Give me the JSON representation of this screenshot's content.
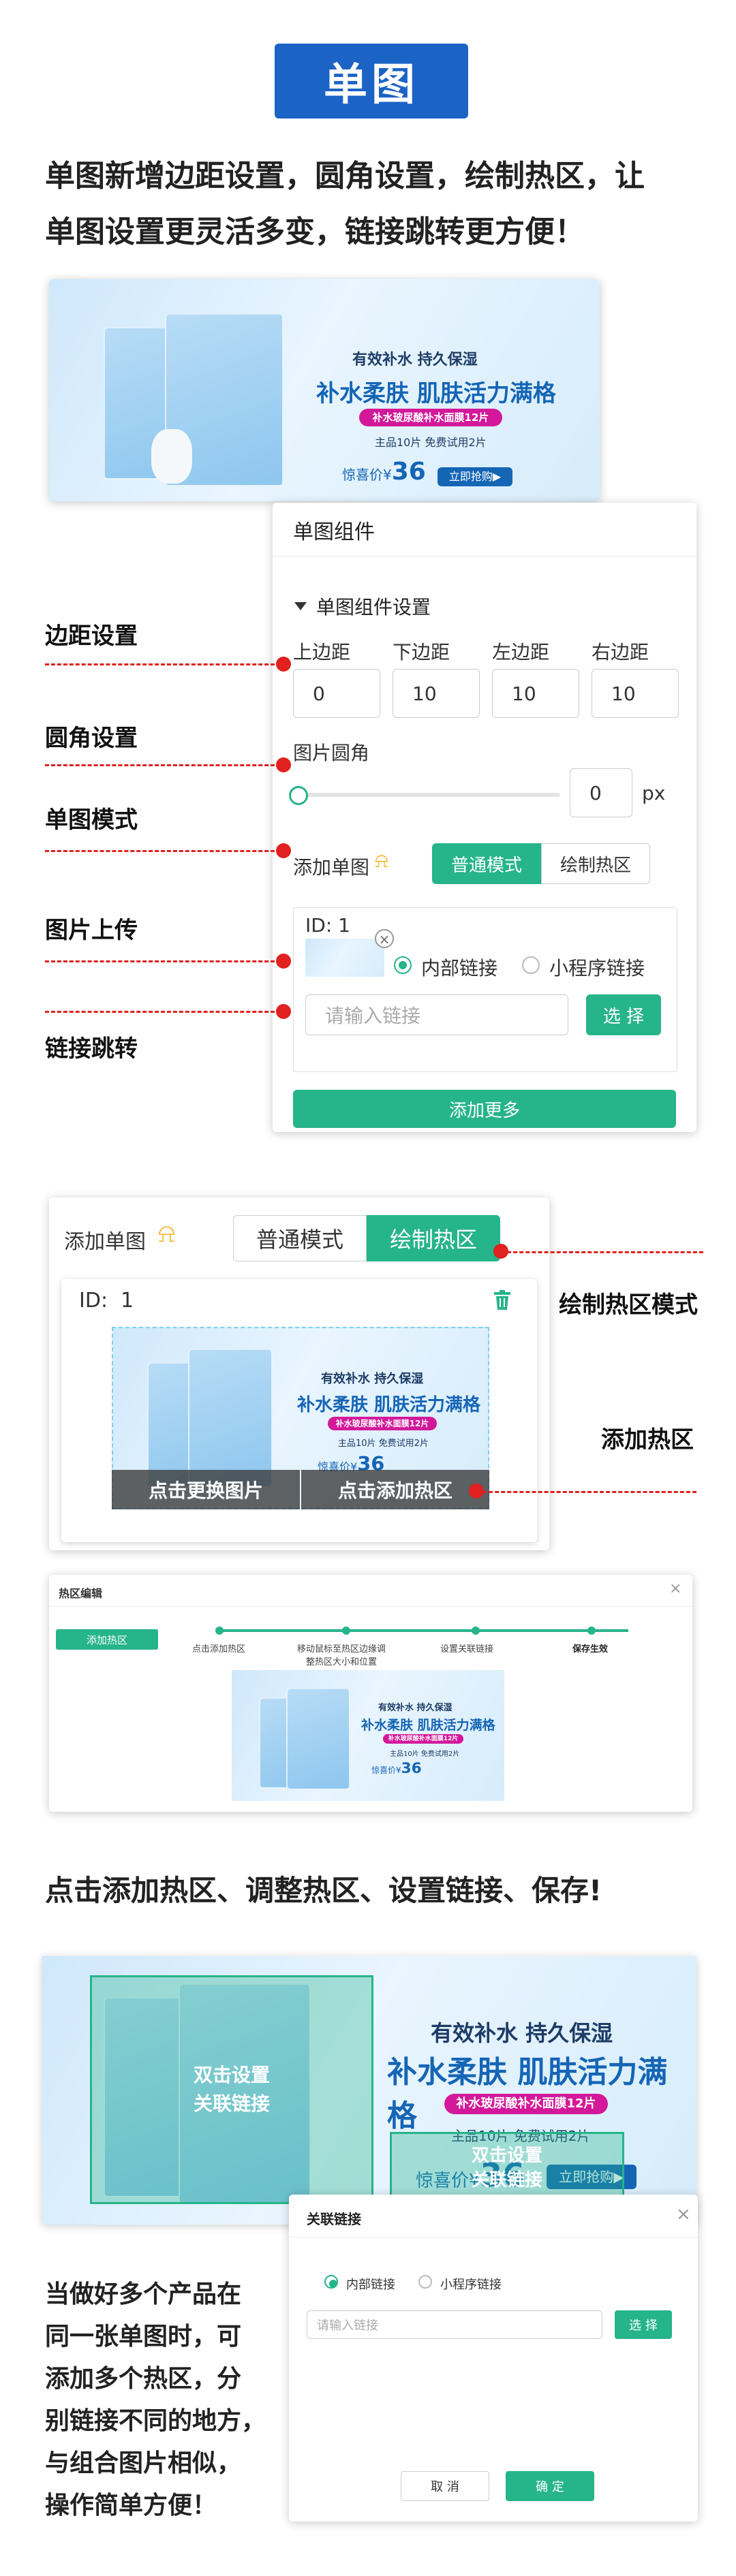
{
  "header": {
    "title": "单图",
    "intro_line1": "单图新增边距设置，圆角设置，绘制热区，让",
    "intro_line2": "单图设置更灵活多变，链接跳转更方便！"
  },
  "banner": {
    "t1": "有效补水 持久保湿",
    "t2": "补水柔肤 肌肤活力满格",
    "pill": "补水玻尿酸补水面膜12片",
    "t3": "主品10片 免费试用2片",
    "price_label": "惊喜价¥",
    "price": "36",
    "buy": "立即抢购▶"
  },
  "panel": {
    "title": "单图组件",
    "section": "单图组件设置",
    "margins": [
      {
        "label": "上边距",
        "value": "0"
      },
      {
        "label": "下边距",
        "value": "10"
      },
      {
        "label": "左边距",
        "value": "10"
      },
      {
        "label": "右边距",
        "value": "10"
      }
    ],
    "radius_label": "图片圆角",
    "radius_value": "0",
    "radius_unit": "px",
    "add_label": "添加单图",
    "mode_normal": "普通模式",
    "mode_hotspot": "绘制热区",
    "id_label": "ID:",
    "id_value": "1",
    "link_internal": "内部链接",
    "link_mini": "小程序链接",
    "link_placeholder": "请输入链接",
    "select": "选 择",
    "add_more": "添加更多"
  },
  "annotations": {
    "margin": "边距设置",
    "radius": "圆角设置",
    "mode": "单图模式",
    "upload": "图片上传",
    "link": "链接跳转",
    "hotspot_mode": "绘制热区模式",
    "add_hotspot": "添加热区"
  },
  "panel2": {
    "add_label": "添加单图",
    "mode_normal": "普通模式",
    "mode_hotspot": "绘制热区",
    "id_label": "ID:",
    "id_value": "1",
    "change_image": "点击更换图片",
    "add_hotspot": "点击添加热区"
  },
  "editor": {
    "title": "热区编辑",
    "add_btn": "添加热区",
    "steps": [
      "点击添加热区",
      "移动鼠标至热区边缘调\n整热区大小和位置",
      "设置关联链接",
      "保存生效"
    ],
    "close": "×"
  },
  "caption": "点击添加热区、调整热区、设置链接、保存!",
  "hotbox": {
    "text1": "双击设置\n关联链接",
    "text2": "双击设置\n关联链接"
  },
  "link_dialog": {
    "title": "关联链接",
    "internal": "内部链接",
    "mini": "小程序链接",
    "placeholder": "请输入链接",
    "select": "选 择",
    "cancel": "取 消",
    "confirm": "确 定",
    "close": "×"
  },
  "bottom_text": [
    "当做好多个产品在",
    "同一张单图时，可",
    "添加多个热区，分",
    "别链接不同的地方，",
    "与组合图片相似，",
    "操作简单方便！"
  ],
  "colors": {
    "brand_blue": "#1c63c6",
    "green": "#26b48a",
    "red": "#e0211f"
  }
}
